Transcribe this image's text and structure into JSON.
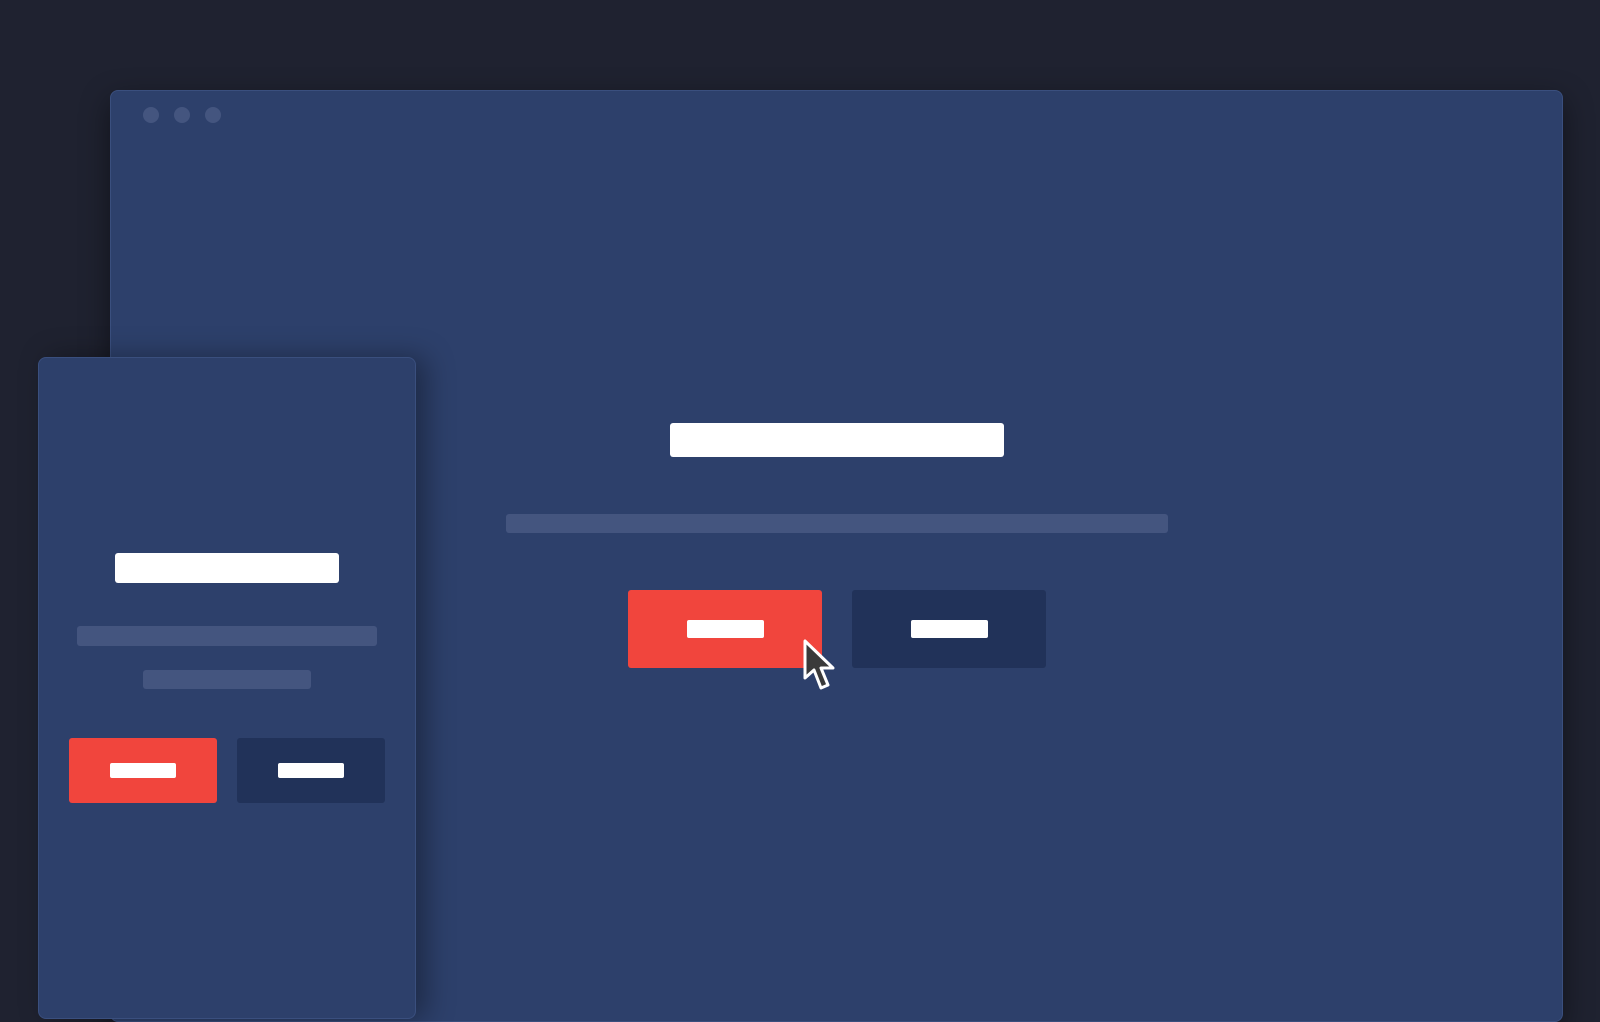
{
  "colors": {
    "desktop": "#1f2230",
    "window": "#2d406b",
    "primary_button": "#f1453d",
    "secondary_button": "#213259",
    "placeholder_text": "#ffffff",
    "placeholder_muted": "#44557f"
  },
  "main_window": {
    "controls": [
      "window-dot",
      "window-dot",
      "window-dot"
    ],
    "buttons": [
      "primary",
      "secondary"
    ]
  },
  "side_panel": {
    "buttons": [
      "primary",
      "secondary"
    ]
  },
  "cursor": {
    "icon": "arrow-pointer-icon"
  }
}
